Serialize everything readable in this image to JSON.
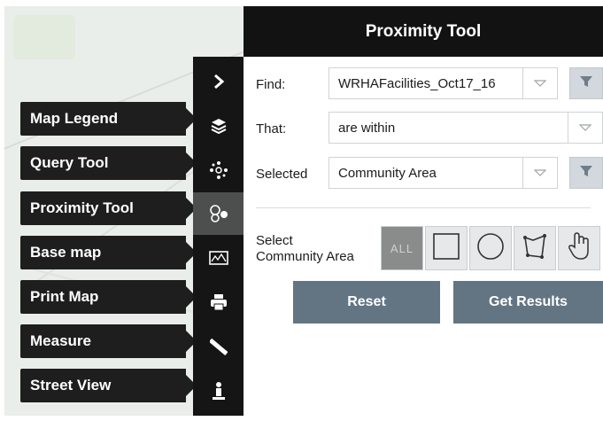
{
  "menu": {
    "items": [
      {
        "label": "Map Legend"
      },
      {
        "label": "Query Tool"
      },
      {
        "label": "Proximity Tool"
      },
      {
        "label": "Base map"
      },
      {
        "label": "Print Map"
      },
      {
        "label": "Measure"
      },
      {
        "label": "Street View"
      }
    ]
  },
  "rail": {
    "expand_icon": "chevron-right-icon",
    "active_item": "Proximity Tool"
  },
  "panel": {
    "title": "Proximity Tool",
    "find_label": "Find:",
    "find_value": "WRHAFacilities_Oct17_16",
    "that_label": "That:",
    "that_value": "are within",
    "selected_label": "Selected",
    "selected_value": "Community Area",
    "select_area_label_line1": "Select",
    "select_area_label_line2": "Community Area",
    "all_label": "ALL",
    "reset_label": "Reset",
    "get_results_label": "Get Results"
  },
  "colors": {
    "header_bg": "#111211",
    "menu_bg": "#1d1e1d",
    "rail_active": "#4d4e4e",
    "action_button": "#637583",
    "all_button": "#8a8b8b"
  }
}
